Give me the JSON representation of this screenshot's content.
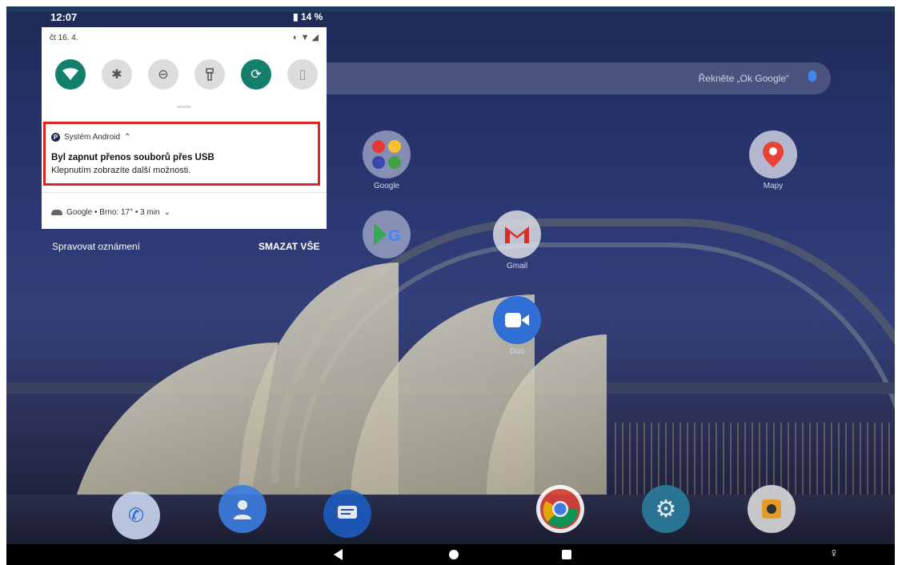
{
  "status_bar": {
    "time": "12:07",
    "battery": "14 %"
  },
  "quick_settings": {
    "date": "čt 16. 4.",
    "tiles": [
      {
        "name": "wifi",
        "state": "on"
      },
      {
        "name": "bluetooth",
        "state": "off"
      },
      {
        "name": "do-not-disturb",
        "state": "off"
      },
      {
        "name": "flashlight",
        "state": "off"
      },
      {
        "name": "auto-rotate",
        "state": "on"
      },
      {
        "name": "battery-saver",
        "state": "off"
      }
    ]
  },
  "notifications": [
    {
      "app": "Systém Android",
      "title": "Byl zapnut přenos souborů přes USB",
      "body": "Klepnutím zobrazíte další možnosti."
    },
    {
      "app": "Google",
      "summary": "Google • Brno: 17° • 3 min"
    }
  ],
  "actions": {
    "manage": "Spravovat oznámení",
    "clear_all": "SMAZAT VŠE"
  },
  "search": {
    "hint": "Řekněte „Ok Google“"
  },
  "apps": {
    "google": "Google",
    "maps": "Mapy",
    "gmail": "Gmail",
    "duo": "Duo"
  }
}
